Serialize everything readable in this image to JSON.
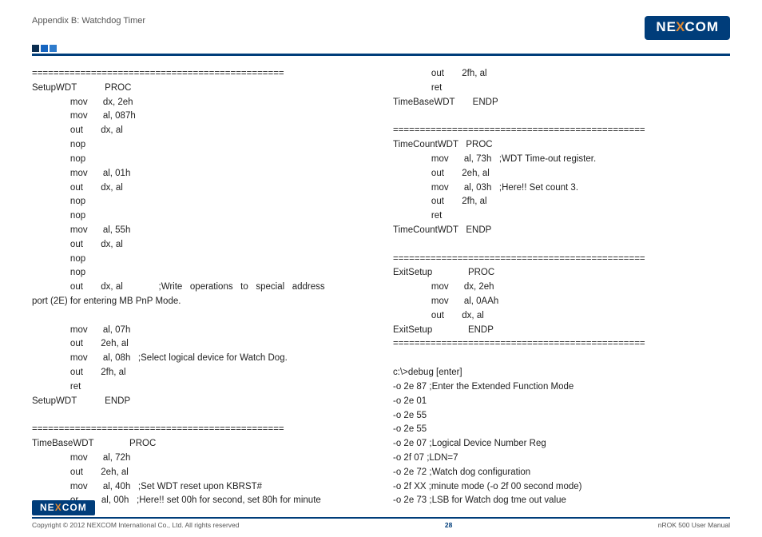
{
  "header": {
    "appendix": "Appendix B: Watchdog Timer",
    "logo_text_1": "N",
    "logo_text_2": "E",
    "logo_text_3": "X",
    "logo_text_4": "COM"
  },
  "code_left": "===============================================\nSetupWDT           PROC\n               mov      dx, 2eh\n               mov      al, 087h\n               out       dx, al\n               nop\n               nop\n               mov      al, 01h\n               out       dx, al\n               nop\n               nop\n               mov      al, 55h\n               out       dx, al\n               nop\n               nop\n               out       dx, al              ;Write   operations   to   special   address\nport (2E) for entering MB PnP Mode.\n\n               mov      al, 07h\n               out       2eh, al\n               mov      al, 08h   ;Select logical device for Watch Dog.\n               out       2fh, al\n               ret\nSetupWDT           ENDP\n\n===============================================\nTimeBaseWDT              PROC\n               mov      al, 72h\n               out       2eh, al\n               mov      al, 40h   ;Set WDT reset upon KBRST#\n               or         al, 00h   ;Here!! set 00h for second, set 80h for minute",
  "code_right": "               out       2fh, al\n               ret\nTimeBaseWDT       ENDP\n\n===============================================\nTimeCountWDT   PROC\n               mov      al, 73h   ;WDT Time-out register.\n               out       2eh, al\n               mov      al, 03h   ;Here!! Set count 3.\n               out       2fh, al\n               ret\nTimeCountWDT   ENDP\n\n===============================================\nExitSetup              PROC\n               mov      dx, 2eh\n               mov      al, 0AAh\n               out       dx, al\nExitSetup              ENDP\n===============================================\n\nc:\\>debug [enter]\n-o 2e 87 ;Enter the Extended Function Mode\n-o 2e 01\n-o 2e 55\n-o 2e 55\n-o 2e 07 ;Logical Device Number Reg\n-o 2f 07 ;LDN=7\n-o 2e 72 ;Watch dog configuration\n-o 2f XX ;minute mode (-o 2f 00 second mode)\n-o 2e 73 ;LSB for Watch dog tme out value",
  "footer": {
    "copyright": "Copyright © 2012 NEXCOM International Co., Ltd. All rights reserved",
    "page_num": "28",
    "manual": "nROK 500 User Manual"
  }
}
